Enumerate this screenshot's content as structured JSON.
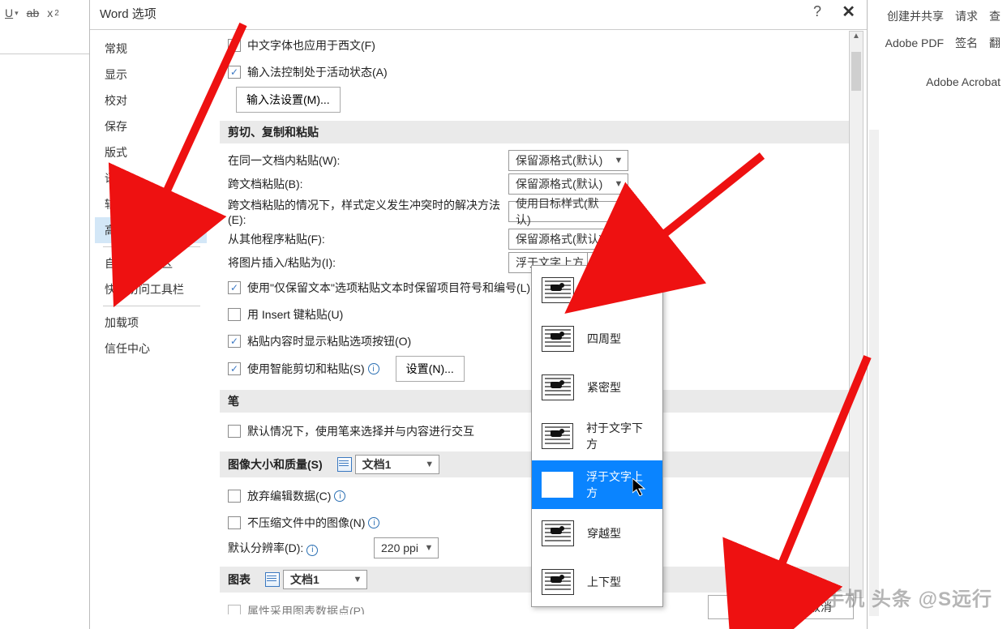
{
  "ribbon": {
    "underline": "U",
    "strike": "ab",
    "subscript": "x",
    "sub_num": "2",
    "right": {
      "r1a": "创建并共享",
      "r1b": "请求",
      "r1c": "查",
      "r2a": "Adobe PDF",
      "r2b": "签名",
      "r2c": "翻",
      "r3": "Adobe Acrobat"
    }
  },
  "dialog": {
    "title": "Word 选项",
    "help": "?",
    "close": "✕"
  },
  "sidebar": {
    "items": [
      "常规",
      "显示",
      "校对",
      "保存",
      "版式",
      "语言",
      "辅助功能",
      "高级",
      "自定义功能区",
      "快速访问工具栏",
      "加载项",
      "信任中心"
    ],
    "selected": 7
  },
  "top": {
    "chk1": "中文字体也应用于西文(F)",
    "chk2": "输入法控制处于活动状态(A)",
    "btn": "输入法设置(M)..."
  },
  "section_paste": "剪切、复制和粘贴",
  "paste": {
    "r1l": "在同一文档内粘贴(W):",
    "r1v": "保留源格式(默认)",
    "r2l": "跨文档粘贴(B):",
    "r2v": "保留源格式(默认)",
    "r3l": "跨文档粘贴的情况下，样式定义发生冲突时的解决方法(E):",
    "r3v": "使用目标样式(默认)",
    "r4l": "从其他程序粘贴(F):",
    "r4v": "保留源格式(默认)",
    "r5l": "将图片插入/粘贴为(I):",
    "r5v": "浮于文字上方",
    "c1": "使用\"仅保留文本\"选项粘贴文本时保留项目符号和编号(L)",
    "c2": "用 Insert 键粘贴(U)",
    "c3": "粘贴内容时显示粘贴选项按钮(O)",
    "c4": "使用智能剪切和粘贴(S)",
    "settings_btn": "设置(N)..."
  },
  "section_pen": "笔",
  "pen": {
    "c1": "默认情况下，使用笔来选择并与内容进行交互"
  },
  "section_img": "图像大小和质量(S)",
  "img": {
    "doc": "文档1",
    "c1": "放弃编辑数据(C)",
    "c2": "不压缩文件中的图像(N)",
    "res_lbl": "默认分辨率(D):",
    "res_val": "220 ppi"
  },
  "section_chart": "图表",
  "chart": {
    "doc": "文档1",
    "cut": "属性采用图表数据点(P)"
  },
  "dropdown": {
    "items": [
      "嵌入型",
      "四周型",
      "紧密型",
      "衬于文字下方",
      "浮于文字上方",
      "穿越型",
      "上下型"
    ],
    "selected": 4
  },
  "footer": {
    "ok": "确定",
    "cancel": "取消"
  },
  "watermark": "@手机 头条 @S远行"
}
